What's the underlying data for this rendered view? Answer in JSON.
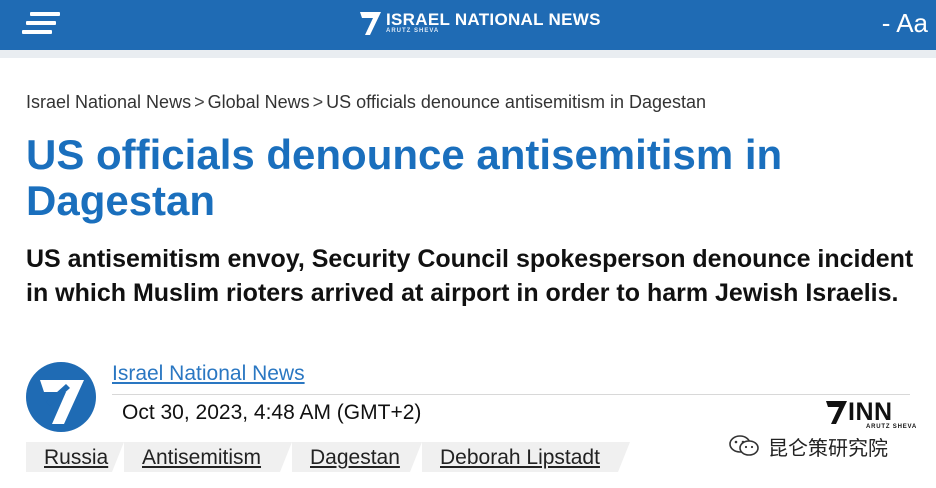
{
  "header": {
    "brand_title": "ISRAEL NATIONAL NEWS",
    "brand_subtitle": "ARUTZ SHEVA",
    "font_size_label": "- Aa",
    "bar_color": "#1f6bb4"
  },
  "breadcrumb": {
    "items": [
      "Israel National News",
      "Global News",
      "US officials denounce antisemitism in Dagestan"
    ],
    "separator": ">"
  },
  "article": {
    "title": "US officials denounce antisemitism in Dagestan",
    "subtitle": "US antisemitism envoy, Security Council spokesperson denounce incident in which Muslim rioters arrived at airport in order to harm Jewish Israelis.",
    "author": "Israel National News",
    "date": "Oct 30, 2023, 4:48 AM (GMT+2)",
    "title_color": "#1a6fbd"
  },
  "source_logo": {
    "name": "INN",
    "subtitle": "ARUTZ SHEVA"
  },
  "tags": [
    "Russia",
    "Antisemitism",
    "Dagestan",
    "Deborah Lipstadt"
  ],
  "watermark": {
    "text": "昆仑策研究院",
    "icon": "wechat-icon"
  }
}
